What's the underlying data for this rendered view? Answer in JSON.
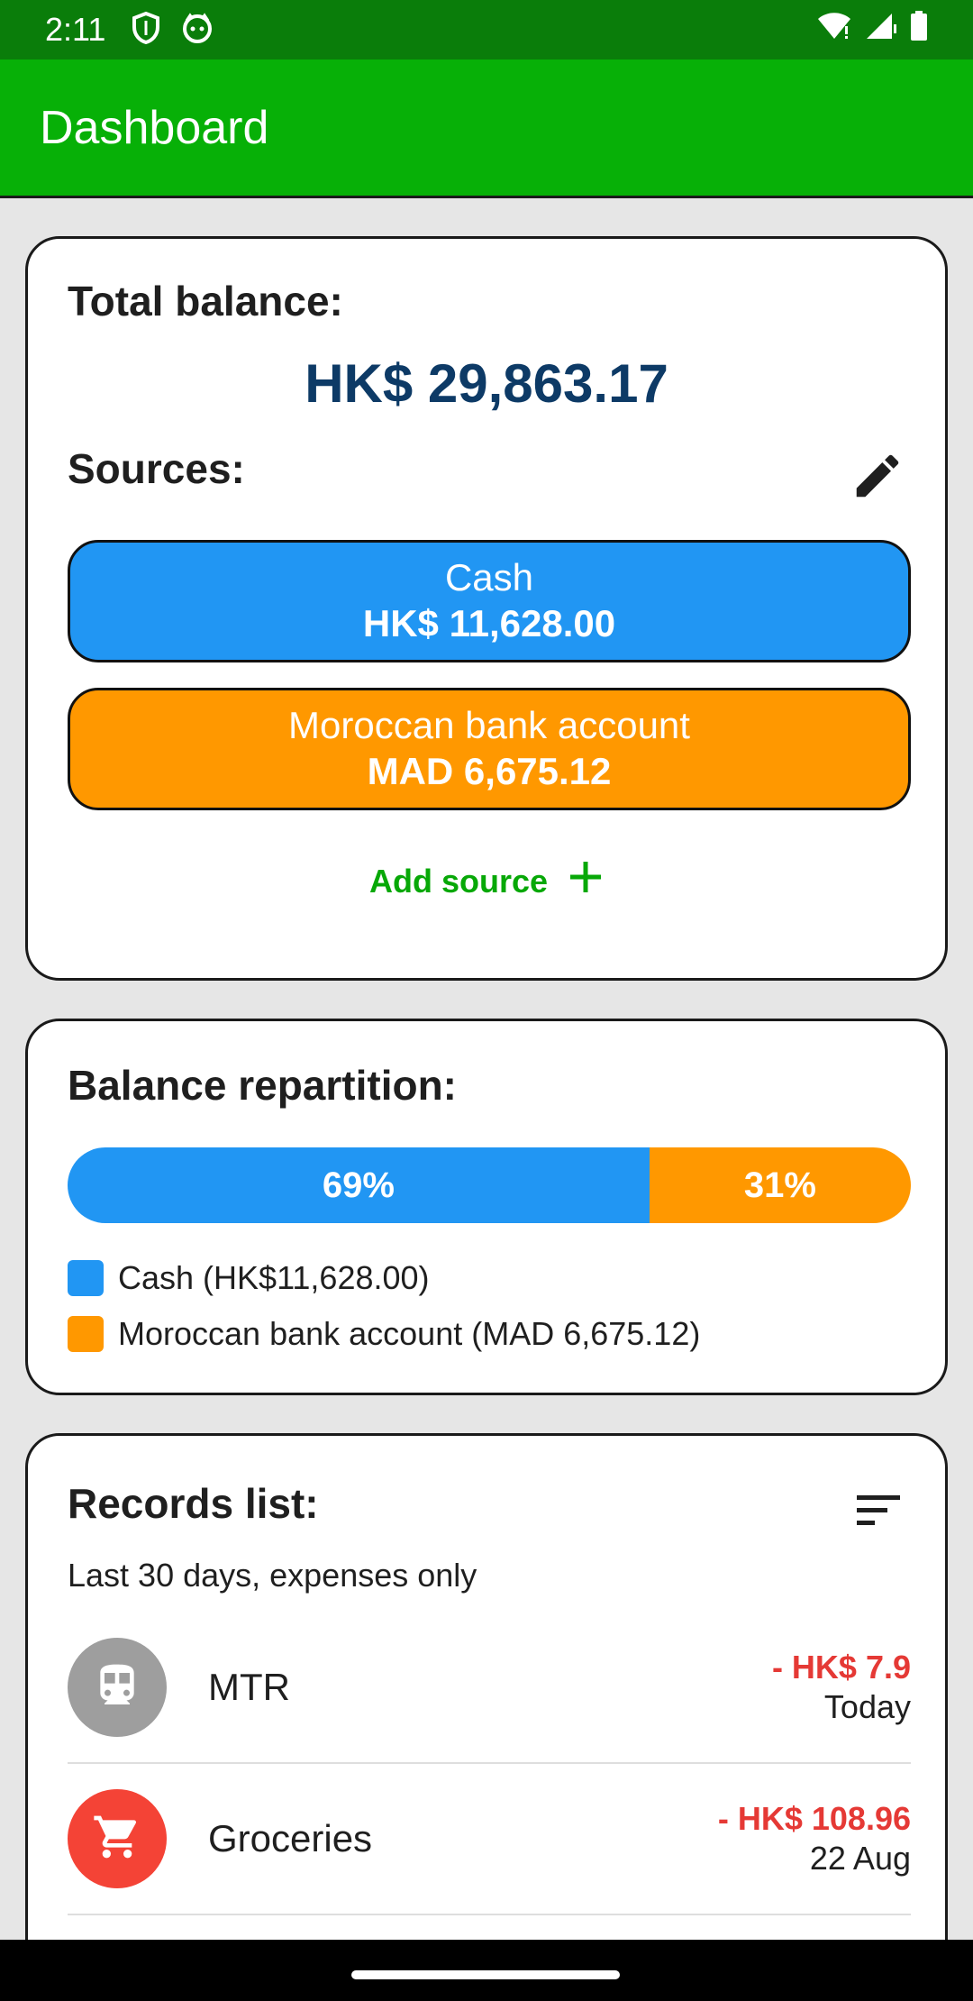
{
  "status_bar": {
    "time": "2:11",
    "icons_left": [
      "shield-icon",
      "cat-face-icon"
    ],
    "icons_right": [
      "wifi-icon",
      "signal-icon",
      "battery-icon"
    ]
  },
  "app_bar": {
    "title": "Dashboard",
    "color": "#07b007"
  },
  "balance_card": {
    "heading": "Total balance:",
    "total": "HK$ 29,863.17",
    "sources_heading": "Sources:",
    "edit_icon": "pencil-icon",
    "sources": [
      {
        "name": "Cash",
        "amount": "HK$ 11,628.00",
        "color": "#2196f3"
      },
      {
        "name": "Moroccan bank account",
        "amount": "MAD 6,675.12",
        "color": "#ff9800"
      }
    ],
    "add_source_label": "Add source",
    "add_icon": "plus-icon"
  },
  "repartition_card": {
    "heading": "Balance repartition:",
    "segments": [
      {
        "label": "69%",
        "fraction": 0.69,
        "color": "#2196f3"
      },
      {
        "label": "31%",
        "fraction": 0.31,
        "color": "#ff9800"
      }
    ],
    "legend": [
      {
        "label": "Cash (HK$11,628.00)",
        "color": "#2196f3"
      },
      {
        "label": "Moroccan bank account (MAD 6,675.12)",
        "color": "#ff9800"
      }
    ]
  },
  "records_card": {
    "heading": "Records list:",
    "sort_icon": "sort-icon",
    "subtitle": "Last 30 days, expenses only",
    "records": [
      {
        "name": "MTR",
        "amount": "- HK$ 7.9",
        "date": "Today",
        "icon": "train-icon",
        "icon_color": "#9e9e9e"
      },
      {
        "name": "Groceries",
        "amount": "- HK$ 108.96",
        "date": "22 Aug",
        "icon": "cart-icon",
        "icon_color": "#f44336"
      }
    ]
  }
}
